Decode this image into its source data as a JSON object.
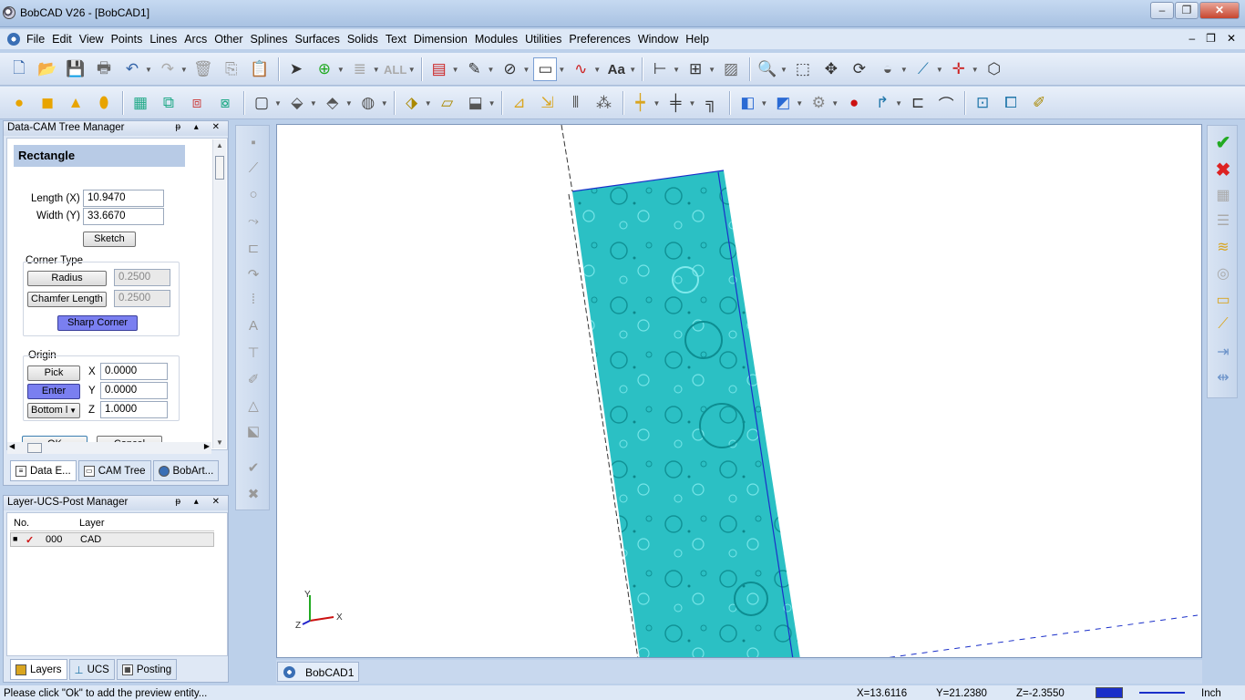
{
  "window": {
    "title": "BobCAD V26 - [BobCAD1]",
    "minimize": "–",
    "maximize": "❐",
    "close": "✕"
  },
  "menu": {
    "items": [
      "File",
      "Edit",
      "View",
      "Points",
      "Lines",
      "Arcs",
      "Other",
      "Splines",
      "Surfaces",
      "Solids",
      "Text",
      "Dimension",
      "Modules",
      "Utilities",
      "Preferences",
      "Window",
      "Help"
    ],
    "mdi_min": "–",
    "mdi_restore": "❐",
    "mdi_close": "✕"
  },
  "toolbar1": {
    "all_label": "ALL",
    "font_label": "Aa"
  },
  "tree_panel": {
    "title": "Data-CAM Tree Manager",
    "controls": "ᵽ ▴ ✕",
    "form_title": "Rectangle",
    "length_label": "Length (X)",
    "length_value": "10.9470",
    "width_label": "Width (Y)",
    "width_value": "33.6670",
    "sketch_label": "Sketch",
    "corner_type_label": "Corner Type",
    "radius_label": "Radius",
    "radius_value": "0.2500",
    "chamfer_label": "Chamfer Length",
    "chamfer_value": "0.2500",
    "sharp_label": "Sharp Corner",
    "origin_label": "Origin",
    "pick_label": "Pick",
    "enter_label": "Enter",
    "position_label": "Bottom l",
    "x_label": "X",
    "x_value": "0.0000",
    "y_label": "Y",
    "y_value": "0.0000",
    "z_label": "Z",
    "z_value": "1.0000",
    "ok_label": "OK",
    "cancel_label": "Cancel",
    "tabs": [
      "Data E...",
      "CAM Tree",
      "BobArt..."
    ]
  },
  "layer_panel": {
    "title": "Layer-UCS-Post Manager",
    "controls": "ᵽ ▴ ✕",
    "col_no": "No.",
    "col_layer": "Layer",
    "rows": [
      {
        "no": "000",
        "layer": "CAD"
      }
    ],
    "tabs": [
      "Layers",
      "UCS",
      "Posting"
    ]
  },
  "viewport": {
    "axis_x": "X",
    "axis_y": "Y",
    "axis_z": "Z",
    "surface_color": "#2bc0c4"
  },
  "doc_tab": "BobCAD1",
  "status": {
    "message": "Please click \"Ok\" to add the preview entity...",
    "x": "X=13.6116",
    "y": "Y=21.2380",
    "z": "Z=-2.3550",
    "units": "Inch"
  }
}
